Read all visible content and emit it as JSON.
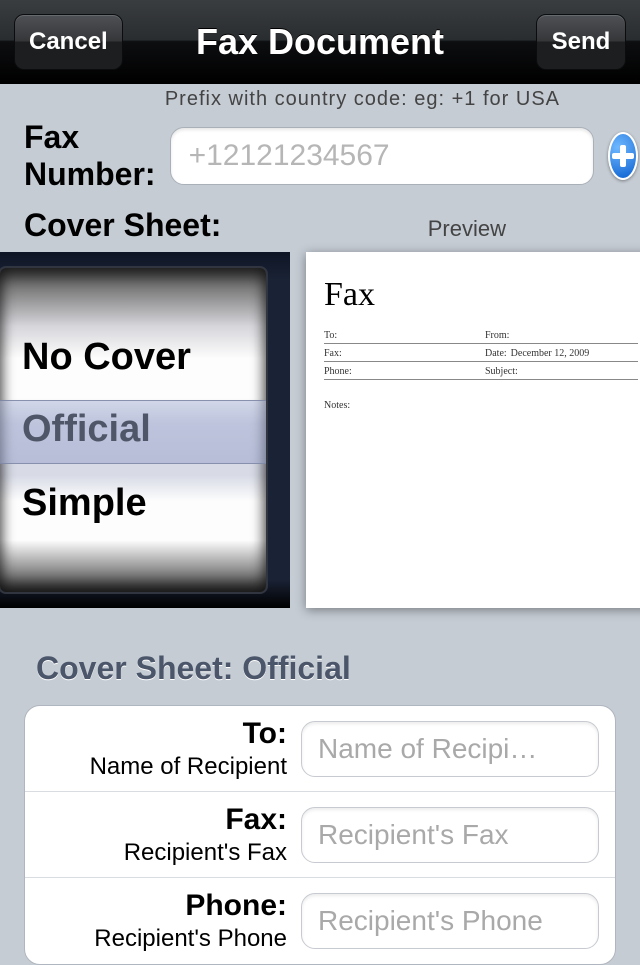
{
  "nav": {
    "cancel": "Cancel",
    "title": "Fax Document",
    "send": "Send"
  },
  "hint": "Prefix with country code: eg: +1 for USA",
  "fax_number": {
    "label": "Fax Number:",
    "placeholder": "+12121234567",
    "value": ""
  },
  "cover_sheet": {
    "label": "Cover Sheet:",
    "preview_label": "Preview",
    "options": [
      "No Cover",
      "Official",
      "Simple"
    ],
    "selected": "Official"
  },
  "preview_doc": {
    "title": "Fax",
    "fields": [
      {
        "l_label": "To:",
        "l_val": "",
        "r_label": "From:",
        "r_val": ""
      },
      {
        "l_label": "Fax:",
        "l_val": "",
        "r_label": "Date:",
        "r_val": "December 12, 2009"
      },
      {
        "l_label": "Phone:",
        "l_val": "",
        "r_label": "Subject:",
        "r_val": ""
      }
    ],
    "notes_label": "Notes:"
  },
  "section_title": "Cover Sheet: Official",
  "form": {
    "rows": [
      {
        "label": "To:",
        "sublabel": "Name of Recipient",
        "placeholder": "Name of Recipi…",
        "value": ""
      },
      {
        "label": "Fax:",
        "sublabel": "Recipient's Fax",
        "placeholder": "Recipient's Fax",
        "value": ""
      },
      {
        "label": "Phone:",
        "sublabel": "Recipient's Phone",
        "placeholder": "Recipient's Phone",
        "value": ""
      }
    ]
  }
}
